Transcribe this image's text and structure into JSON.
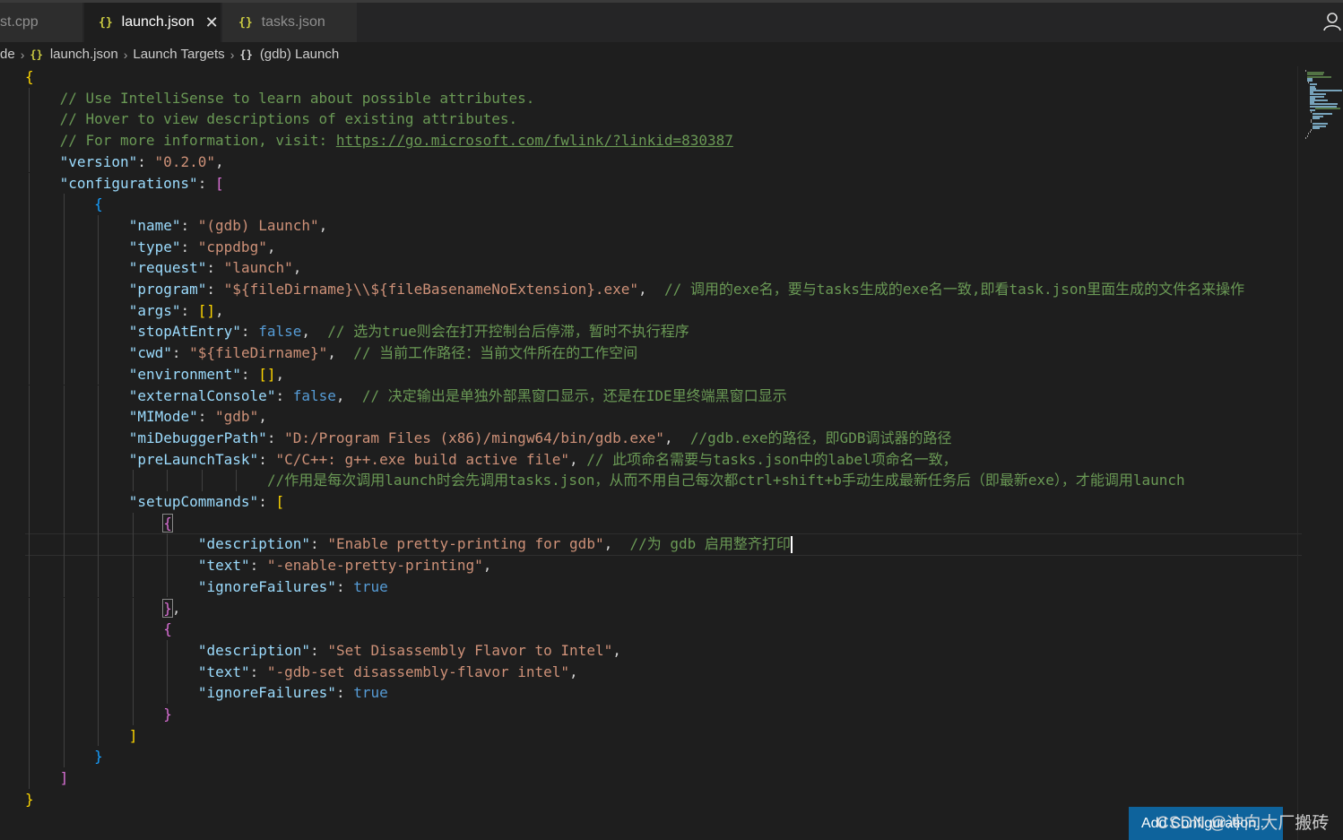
{
  "tabs": [
    {
      "label": "st.cpp",
      "active": false
    },
    {
      "label": "launch.json",
      "active": true,
      "icon": "json-braces-icon",
      "close": "✕"
    },
    {
      "label": "tasks.json",
      "active": false,
      "icon": "json-braces-icon"
    }
  ],
  "breadcrumb": {
    "first": "de",
    "file": "launch.json",
    "section": "Launch Targets",
    "item": "(gdb) Launch"
  },
  "editor": {
    "lines": [
      "{",
      "    // Use IntelliSense to learn about possible attributes.",
      "    // Hover to view descriptions of existing attributes.",
      "    // For more information, visit: https://go.microsoft.com/fwlink/?linkid=830387",
      "    \"version\": \"0.2.0\",",
      "    \"configurations\": [",
      "        {",
      "            \"name\": \"(gdb) Launch\",",
      "            \"type\": \"cppdbg\",",
      "            \"request\": \"launch\",",
      "            \"program\": \"${fileDirname}\\\\${fileBasenameNoExtension}.exe\",  // 调用的exe名，要与tasks生成的exe名一致,即看task.json里面生成的文件名来操作",
      "            \"args\": [],",
      "            \"stopAtEntry\": false,  // 选为true则会在打开控制台后停滞，暂时不执行程序",
      "            \"cwd\": \"${fileDirname}\",  // 当前工作路径：当前文件所在的工作空间",
      "            \"environment\": [],",
      "            \"externalConsole\": false,  // 决定输出是单独外部黑窗口显示，还是在IDE里终端黑窗口显示",
      "            \"MIMode\": \"gdb\",",
      "            \"miDebuggerPath\": \"D:/Program Files (x86)/mingw64/bin/gdb.exe\",  //gdb.exe的路径，即GDB调试器的路径",
      "            \"preLaunchTask\": \"C/C++: g++.exe build active file\", // 此项命名需要与tasks.json中的label项命名一致，",
      "                            //作用是每次调用launch时会先调用tasks.json，从而不用自己每次都ctrl+shift+b手动生成最新任务后（即最新exe），才能调用launch",
      "            \"setupCommands\": [",
      "                {",
      "                    \"description\": \"Enable pretty-printing for gdb\",  //为 gdb 启用整齐打印",
      "                    \"text\": \"-enable-pretty-printing\",",
      "                    \"ignoreFailures\": true",
      "                },",
      "                {",
      "                    \"description\": \"Set Disassembly Flavor to Intel\",",
      "                    \"text\": \"-gdb-set disassembly-flavor intel\",",
      "                    \"ignoreFailures\": true",
      "                }",
      "            ]",
      "        }",
      "    ]",
      "}"
    ]
  },
  "add_configuration": "Add Configuration...",
  "watermark": "CSDN @冲向大厂搬砖",
  "colors": {
    "comment": "#6a9955",
    "key": "#9cdcfe",
    "string": "#ce9178",
    "keyword": "#569cd6",
    "bracket_1": "#ffd700",
    "bracket_2": "#da70d6",
    "bracket_3": "#179fff",
    "button": "#0e639c"
  }
}
